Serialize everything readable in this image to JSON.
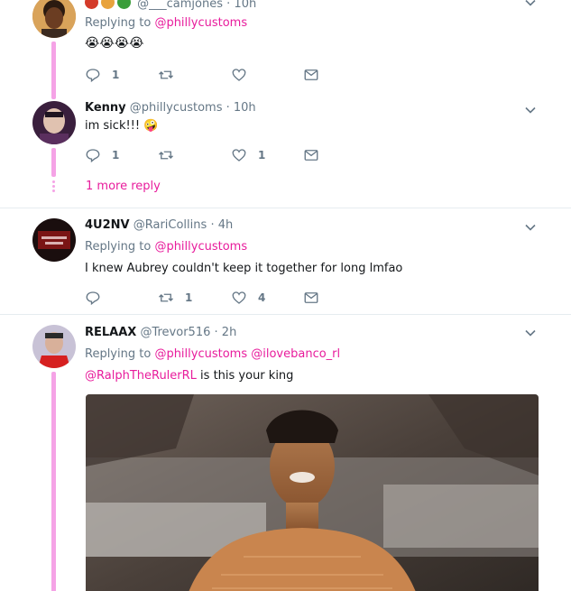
{
  "tweets": [
    {
      "name": "",
      "handle": "@___camjones",
      "time": "10h",
      "replying_label": "Replying to",
      "replying_to": [
        "@phillycustoms"
      ],
      "text": "",
      "emoji_row": "😭😭😭😭",
      "actions": {
        "reply": "1",
        "retweet": "",
        "like": "",
        "dm": ""
      }
    },
    {
      "name": "Kenny",
      "handle": "@phillycustoms",
      "time": "10h",
      "text": "im sick!!! 🤪",
      "actions": {
        "reply": "1",
        "retweet": "",
        "like": "1",
        "dm": ""
      },
      "more_reply": "1 more reply"
    },
    {
      "name": "4U2NV",
      "handle": "@RariCollins",
      "time": "4h",
      "replying_label": "Replying to",
      "replying_to": [
        "@phillycustoms"
      ],
      "text": "I knew Aubrey couldn't keep it together for long lmfao",
      "actions": {
        "reply": "",
        "retweet": "1",
        "like": "4",
        "dm": ""
      }
    },
    {
      "name": "RELAAX",
      "handle": "@Trevor516",
      "time": "2h",
      "replying_label": "Replying to",
      "replying_to": [
        "@phillycustoms",
        "@ilovebanco_rl"
      ],
      "text_mention": "@RalphTheRulerRL",
      "text": " is this your king",
      "media": "gif"
    }
  ],
  "sep": "·",
  "colors": {
    "accent": "#e81c9c",
    "thread": "#f5a3e6",
    "muted": "#657786",
    "divider": "#e6ecf0"
  }
}
